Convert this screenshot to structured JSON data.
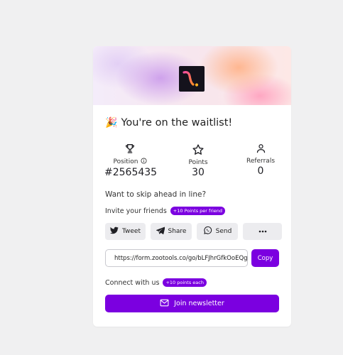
{
  "waitlist": {
    "title_emoji": "🎉",
    "title": "You're on the waitlist!"
  },
  "stats": {
    "position": {
      "icon": "trophy-icon",
      "label": "Position",
      "info_icon": "info-icon",
      "value": "#2565435"
    },
    "points": {
      "icon": "star-icon",
      "label": "Points",
      "value": "30"
    },
    "referrals": {
      "icon": "user-icon",
      "label": "Referrals",
      "value": "0"
    }
  },
  "invite": {
    "prompt": "Want to skip ahead in line?",
    "label": "Invite your friends",
    "badge": "+10 Points per friend",
    "buttons": [
      {
        "icon": "twitter-icon",
        "label": "Tweet"
      },
      {
        "icon": "send-icon",
        "label": "Share"
      },
      {
        "icon": "whatsapp-icon",
        "label": "Send"
      },
      {
        "icon": "more-icon",
        "label": ""
      }
    ],
    "referral_url": "https://form.zootools.co/go/bLFJhrGfkOoEQg",
    "copy_label": "Copy"
  },
  "connect": {
    "label": "Connect with us",
    "badge": "+10 points each",
    "newsletter_icon": "mail-icon",
    "newsletter_label": "Join newsletter"
  },
  "colors": {
    "accent": "#7b00e0",
    "background": "#f0f0f1",
    "card": "#ffffff",
    "button_gray": "#ececef"
  }
}
